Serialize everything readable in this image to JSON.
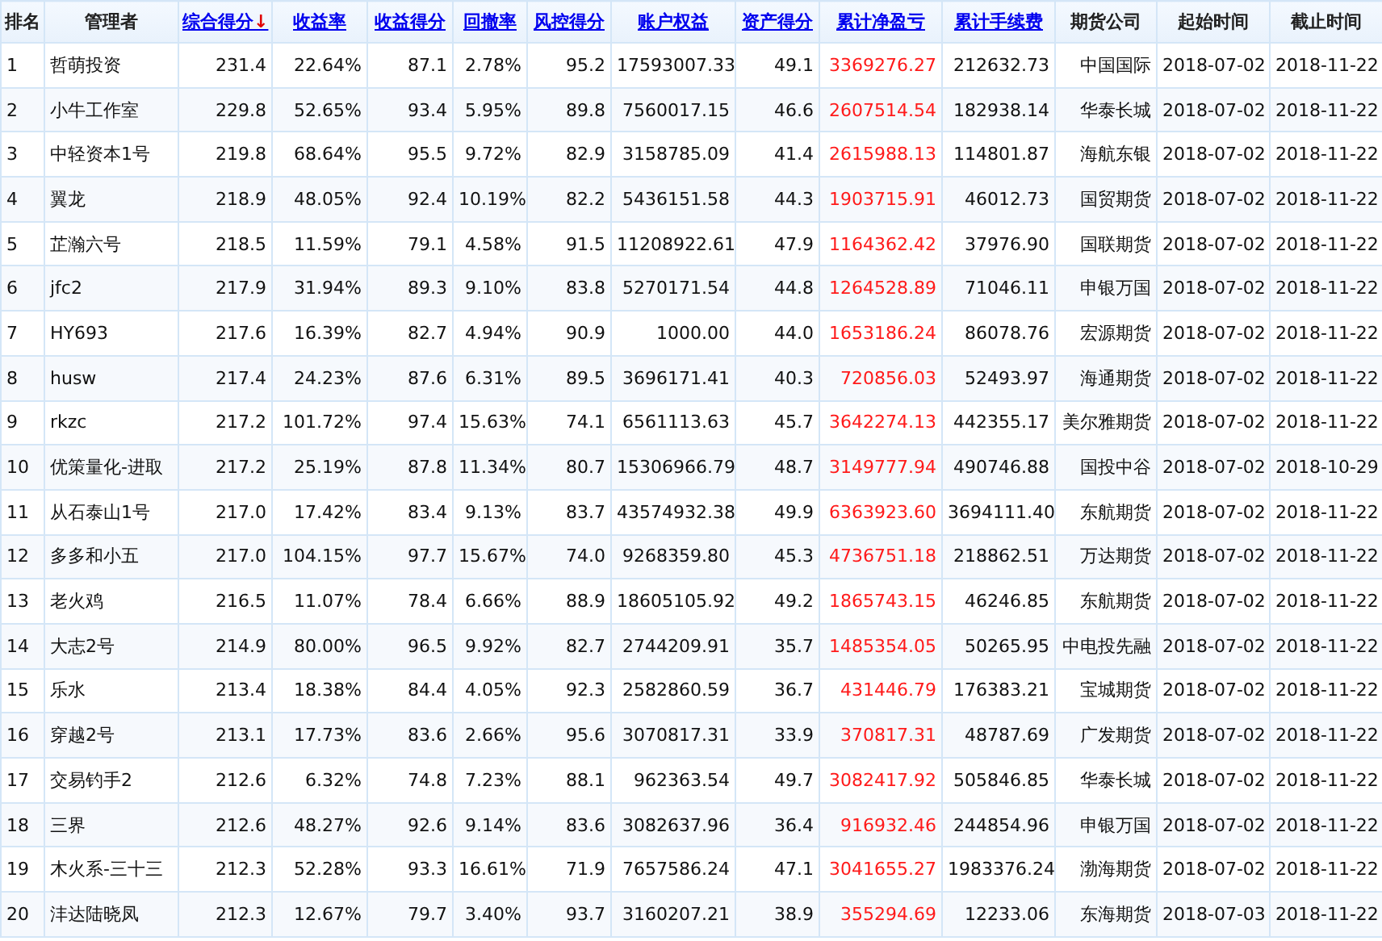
{
  "table": {
    "columns": [
      {
        "label": "排名",
        "kind": "plain"
      },
      {
        "label": "管理者",
        "kind": "plain"
      },
      {
        "label": "综合得分",
        "kind": "link",
        "sort_mark": "↓"
      },
      {
        "label": "收益率",
        "kind": "link"
      },
      {
        "label": "收益得分",
        "kind": "link"
      },
      {
        "label": "回撤率",
        "kind": "link"
      },
      {
        "label": "风控得分",
        "kind": "link"
      },
      {
        "label": "账户权益",
        "kind": "link"
      },
      {
        "label": "资产得分",
        "kind": "link"
      },
      {
        "label": "累计净盈亏",
        "kind": "profit-link"
      },
      {
        "label": "累计手续费",
        "kind": "link"
      },
      {
        "label": "期货公司",
        "kind": "plain"
      },
      {
        "label": "起始时间",
        "kind": "plain"
      },
      {
        "label": "截止时间",
        "kind": "plain"
      }
    ],
    "rows": [
      [
        "1",
        "哲萌投资",
        "231.4",
        "22.64%",
        "87.1",
        "2.78%",
        "95.2",
        "17593007.33",
        "49.1",
        "3369276.27",
        "212632.73",
        "中国国际",
        "2018-07-02",
        "2018-11-22"
      ],
      [
        "2",
        "小牛工作室",
        "229.8",
        "52.65%",
        "93.4",
        "5.95%",
        "89.8",
        "7560017.15",
        "46.6",
        "2607514.54",
        "182938.14",
        "华泰长城",
        "2018-07-02",
        "2018-11-22"
      ],
      [
        "3",
        "中轻资本1号",
        "219.8",
        "68.64%",
        "95.5",
        "9.72%",
        "82.9",
        "3158785.09",
        "41.4",
        "2615988.13",
        "114801.87",
        "海航东银",
        "2018-07-02",
        "2018-11-22"
      ],
      [
        "4",
        "翼龙",
        "218.9",
        "48.05%",
        "92.4",
        "10.19%",
        "82.2",
        "5436151.58",
        "44.3",
        "1903715.91",
        "46012.73",
        "国贸期货",
        "2018-07-02",
        "2018-11-22"
      ],
      [
        "5",
        "芷瀚六号",
        "218.5",
        "11.59%",
        "79.1",
        "4.58%",
        "91.5",
        "11208922.61",
        "47.9",
        "1164362.42",
        "37976.90",
        "国联期货",
        "2018-07-02",
        "2018-11-22"
      ],
      [
        "6",
        "jfc2",
        "217.9",
        "31.94%",
        "89.3",
        "9.10%",
        "83.8",
        "5270171.54",
        "44.8",
        "1264528.89",
        "71046.11",
        "申银万国",
        "2018-07-02",
        "2018-11-22"
      ],
      [
        "7",
        "HY693",
        "217.6",
        "16.39%",
        "82.7",
        "4.94%",
        "90.9",
        "1000.00",
        "44.0",
        "1653186.24",
        "86078.76",
        "宏源期货",
        "2018-07-02",
        "2018-11-22"
      ],
      [
        "8",
        "husw",
        "217.4",
        "24.23%",
        "87.6",
        "6.31%",
        "89.5",
        "3696171.41",
        "40.3",
        "720856.03",
        "52493.97",
        "海通期货",
        "2018-07-02",
        "2018-11-22"
      ],
      [
        "9",
        "rkzc",
        "217.2",
        "101.72%",
        "97.4",
        "15.63%",
        "74.1",
        "6561113.63",
        "45.7",
        "3642274.13",
        "442355.17",
        "美尔雅期货",
        "2018-07-02",
        "2018-11-22"
      ],
      [
        "10",
        "优策量化-进取",
        "217.2",
        "25.19%",
        "87.8",
        "11.34%",
        "80.7",
        "15306966.79",
        "48.7",
        "3149777.94",
        "490746.88",
        "国投中谷",
        "2018-07-02",
        "2018-10-29"
      ],
      [
        "11",
        "从石泰山1号",
        "217.0",
        "17.42%",
        "83.4",
        "9.13%",
        "83.7",
        "43574932.38",
        "49.9",
        "6363923.60",
        "3694111.40",
        "东航期货",
        "2018-07-02",
        "2018-11-22"
      ],
      [
        "12",
        "多多和小五",
        "217.0",
        "104.15%",
        "97.7",
        "15.67%",
        "74.0",
        "9268359.80",
        "45.3",
        "4736751.18",
        "218862.51",
        "万达期货",
        "2018-07-02",
        "2018-11-22"
      ],
      [
        "13",
        "老火鸡",
        "216.5",
        "11.07%",
        "78.4",
        "6.66%",
        "88.9",
        "18605105.92",
        "49.2",
        "1865743.15",
        "46246.85",
        "东航期货",
        "2018-07-02",
        "2018-11-22"
      ],
      [
        "14",
        "大志2号",
        "214.9",
        "80.00%",
        "96.5",
        "9.92%",
        "82.7",
        "2744209.91",
        "35.7",
        "1485354.05",
        "50265.95",
        "中电投先融",
        "2018-07-02",
        "2018-11-22"
      ],
      [
        "15",
        "乐水",
        "213.4",
        "18.38%",
        "84.4",
        "4.05%",
        "92.3",
        "2582860.59",
        "36.7",
        "431446.79",
        "176383.21",
        "宝城期货",
        "2018-07-02",
        "2018-11-22"
      ],
      [
        "16",
        "穿越2号",
        "213.1",
        "17.73%",
        "83.6",
        "2.66%",
        "95.6",
        "3070817.31",
        "33.9",
        "370817.31",
        "48787.69",
        "广发期货",
        "2018-07-02",
        "2018-11-22"
      ],
      [
        "17",
        "交易钓手2",
        "212.6",
        "6.32%",
        "74.8",
        "7.23%",
        "88.1",
        "962363.54",
        "49.7",
        "3082417.92",
        "505846.85",
        "华泰长城",
        "2018-07-02",
        "2018-11-22"
      ],
      [
        "18",
        "三界",
        "212.6",
        "48.27%",
        "92.6",
        "9.14%",
        "83.6",
        "3082637.96",
        "36.4",
        "916932.46",
        "244854.96",
        "申银万国",
        "2018-07-02",
        "2018-11-22"
      ],
      [
        "19",
        "木火系-三十三",
        "212.3",
        "52.28%",
        "93.3",
        "16.61%",
        "71.9",
        "7657586.24",
        "47.1",
        "3041655.27",
        "1983376.24",
        "渤海期货",
        "2018-07-02",
        "2018-11-22"
      ],
      [
        "20",
        "沣达陆晓凤",
        "212.3",
        "12.67%",
        "79.7",
        "3.40%",
        "93.7",
        "3160207.21",
        "38.9",
        "355294.69",
        "12233.06",
        "东海期货",
        "2018-07-03",
        "2018-11-22"
      ]
    ]
  }
}
